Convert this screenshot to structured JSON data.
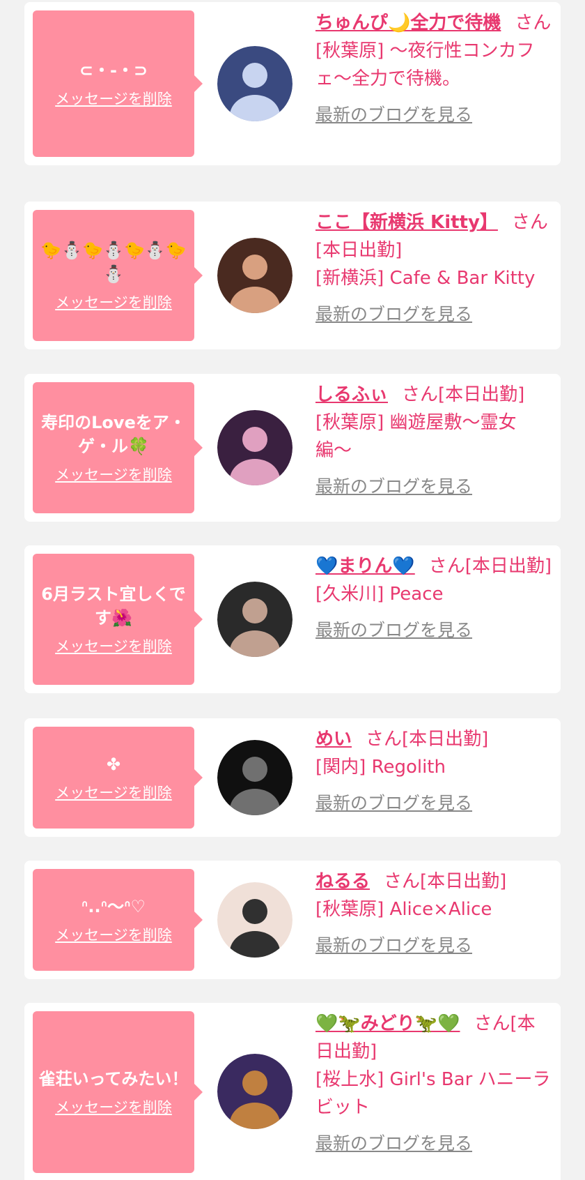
{
  "delete_label": "メッセージを削除",
  "blog_label": "最新のブログを見る",
  "cards": [
    {
      "message": "⊂・-・⊃",
      "name": "ちゅんぴ🌙全力で待機",
      "status": "さん",
      "shop": "[秋葉原] 〜夜行性コンカフェ〜全力で待機。"
    },
    {
      "message": "🐤⛄🐤⛄🐤⛄🐤⛄",
      "name": "ここ【新横浜 Kitty】",
      "status": "さん[本日出勤]",
      "shop": "[新横浜] Cafe & Bar Kitty"
    },
    {
      "message": "寿印のLoveをア・ゲ・ル🍀",
      "name": "しるふぃ",
      "status": "さん[本日出勤]",
      "shop": "[秋葉原] 幽遊屋敷〜霊女編〜"
    },
    {
      "message": "6月ラスト宜しくです🌺",
      "name": "💙まりん💙",
      "status": "さん[本日出勤]",
      "shop": "[久米川] Peace"
    },
    {
      "message": "✤",
      "name": "めい",
      "status": "さん[本日出勤]",
      "shop": "[関内] Regolith"
    },
    {
      "message": "ᐢ..ᐢ〜ᐢ♡",
      "name": "ねるる",
      "status": "さん[本日出勤]",
      "shop": "[秋葉原] Alice×Alice"
    },
    {
      "message": "雀荘いってみたい！",
      "name": "💚🦖みどり🦖💚",
      "status": "さん[本日出勤]",
      "shop": "[桜上水] Girl's Bar ハニーラビット"
    }
  ],
  "avatar_colors": [
    [
      "#3a4a80",
      "#c8d4f0"
    ],
    [
      "#4a2a20",
      "#d8a080"
    ],
    [
      "#3a2040",
      "#e0a0c0"
    ],
    [
      "#2a2a2a",
      "#c0a090"
    ],
    [
      "#101010",
      "#707070"
    ],
    [
      "#f0e0d8",
      "#303030"
    ],
    [
      "#3a2a60",
      "#c08040"
    ]
  ]
}
